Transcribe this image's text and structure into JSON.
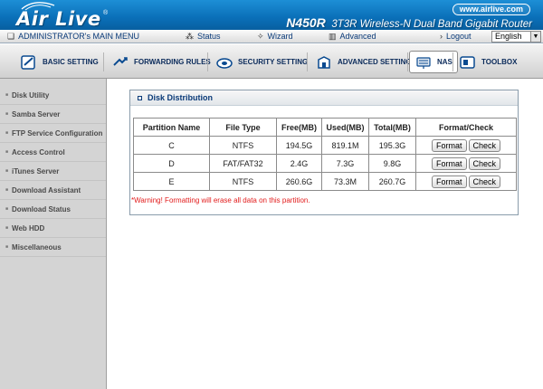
{
  "header": {
    "brand": "Air Live",
    "registered_mark": "®",
    "site_url": "www.airlive.com",
    "model": "N450R",
    "description": "3T3R Wireless-N Dual Band Gigabit Router"
  },
  "menu": {
    "admin_label": "ADMINISTRATOR's MAIN MENU",
    "status": "Status",
    "wizard": "Wizard",
    "advanced": "Advanced",
    "logout": "Logout",
    "language": "English"
  },
  "tabs": [
    {
      "label": "BASIC SETTING",
      "icon": "basic-setting-icon"
    },
    {
      "label": "FORWARDING RULES",
      "icon": "forwarding-rules-icon"
    },
    {
      "label": "SECURITY SETTING",
      "icon": "security-setting-icon"
    },
    {
      "label": "ADVANCED SETTING",
      "icon": "advanced-setting-icon"
    },
    {
      "label": "NAS",
      "icon": "nas-icon",
      "active": true
    },
    {
      "label": "TOOLBOX",
      "icon": "toolbox-icon"
    }
  ],
  "sidebar": {
    "items": [
      "Disk Utility",
      "Samba Server",
      "FTP Service Configuration",
      "Access Control",
      "iTunes Server",
      "Download Assistant",
      "Download Status",
      "Web HDD",
      "Miscellaneous"
    ]
  },
  "panel": {
    "title": "Disk Distribution",
    "columns": [
      "Partition Name",
      "File Type",
      "Free(MB)",
      "Used(MB)",
      "Total(MB)",
      "Format/Check"
    ],
    "rows": [
      {
        "name": "C",
        "type": "NTFS",
        "free": "194.5G",
        "used": "819.1M",
        "total": "195.3G"
      },
      {
        "name": "D",
        "type": "FAT/FAT32",
        "free": "2.4G",
        "used": "7.3G",
        "total": "9.8G"
      },
      {
        "name": "E",
        "type": "NTFS",
        "free": "260.6G",
        "used": "73.3M",
        "total": "260.7G"
      }
    ],
    "format_label": "Format",
    "check_label": "Check",
    "warning": "*Warning! Formatting will erase all data on this partition."
  },
  "colors": {
    "header_blue": "#0a6fb8",
    "menu_text": "#0a3a78",
    "warning_red": "#e21b1b",
    "sidebar_bg": "#d4d4d4"
  }
}
